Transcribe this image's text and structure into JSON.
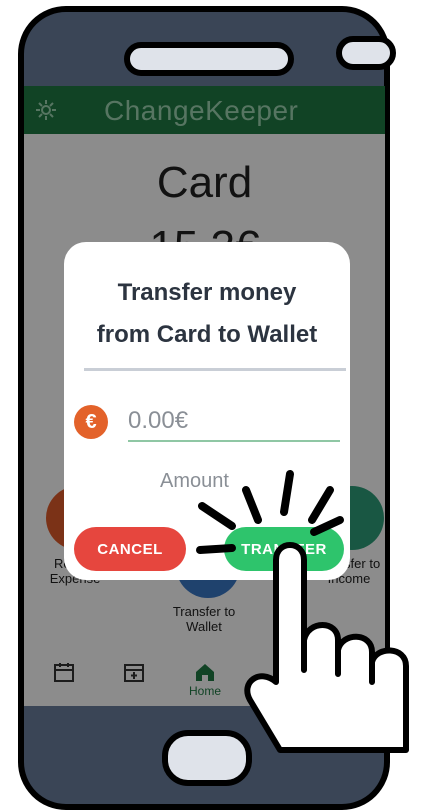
{
  "app": {
    "title": "ChangeKeeper"
  },
  "card": {
    "title": "Card",
    "amount": "15.3€"
  },
  "actions": {
    "left_label": "Record Expense",
    "right_label": "Transfer to Income",
    "middle_label": "Transfer to Wallet"
  },
  "nav": {
    "items": [
      {
        "label": ""
      },
      {
        "label": ""
      },
      {
        "label": "Home"
      },
      {
        "label": ""
      }
    ]
  },
  "dialog": {
    "title_line1": "Transfer money",
    "title_line2": "from Card to Wallet",
    "currency_symbol": "€",
    "amount_placeholder": "0.00€",
    "amount_label": "Amount",
    "cancel_label": "CANCEL",
    "transfer_label": "TRANSFER"
  },
  "colors": {
    "header": "#1f7a44",
    "cancel": "#e6463e",
    "transfer": "#2ec46c",
    "euro": "#e3622a"
  }
}
